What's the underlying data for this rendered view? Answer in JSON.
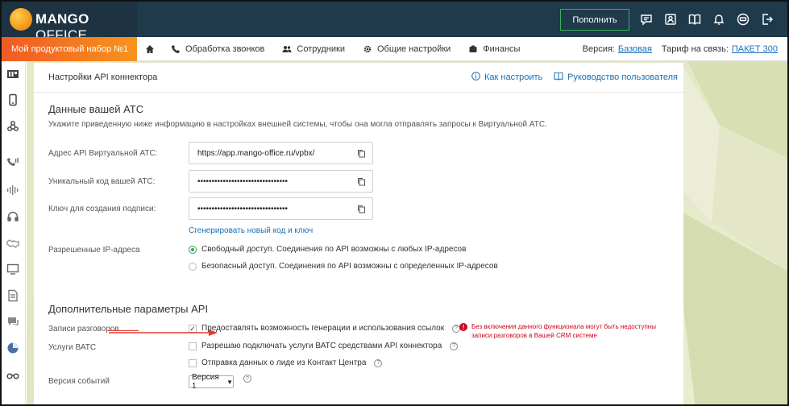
{
  "header": {
    "logo_text_bold": "MANGO",
    "logo_text_light": "OFFICE",
    "topup_label": "Пополнить",
    "icons": [
      "chat-icon",
      "contacts-icon",
      "book-icon",
      "bell-icon",
      "user-icon",
      "logout-icon"
    ]
  },
  "nav": {
    "plan_label": "Мой продуктовый набор №1",
    "items": [
      {
        "label": "Обработка звонков",
        "icon": "phone-icon"
      },
      {
        "label": "Сотрудники",
        "icon": "people-icon"
      },
      {
        "label": "Общие настройки",
        "icon": "gear-icon"
      },
      {
        "label": "Финансы",
        "icon": "wallet-icon"
      }
    ],
    "version_label": "Версия:",
    "version_value": "Базовая",
    "tariff_label": "Тариф на связь:",
    "tariff_value": "ПАКЕТ 300"
  },
  "panel": {
    "title": "Настройки API коннектора",
    "how_to_link": "Как настроить",
    "guide_link": "Руководство пользователя",
    "ats_section": {
      "title": "Данные вашей АТС",
      "description": "Укажите приведенную ниже информацию в настройках внешней системы, чтобы она могла отправлять запросы к Виртуальной АТС.",
      "api_address_label": "Адрес API Виртуальной АТС:",
      "api_address_value": "https://app.mango-office.ru/vpbx/",
      "unique_code_label": "Уникальный код вашей АТС:",
      "unique_code_value": "••••••••••••••••••••••••••••••••",
      "signature_key_label": "Ключ для создания подписи:",
      "signature_key_value": "••••••••••••••••••••••••••••••••",
      "generate_link": "Сгенерировать новый код и ключ",
      "allowed_ip_label": "Разрешенные IP-адреса",
      "radio_free": "Свободный доступ. Соединения по API возможны с любых IP-адресов",
      "radio_secure": "Безопасный доступ. Соединения по API возможны с определенных IP-адресов"
    },
    "extra_section": {
      "title": "Дополнительные параметры API",
      "recordings_label": "Записи разговоров",
      "recordings_checkbox": "Предоставлять возможность генерации и использования ссылок",
      "warning": "Без включения данного функционала могут быть недоступны записи разговоров в Вашей CRM системе",
      "vats_services_label": "Услуги ВАТС",
      "allow_services_checkbox": "Разрешаю подключать услуги ВАТС средствами API коннектора",
      "lead_data_checkbox": "Отправка данных о лиде из Контакт Центра",
      "events_version_label": "Версия событий",
      "events_version_value": "Версия 1"
    }
  }
}
